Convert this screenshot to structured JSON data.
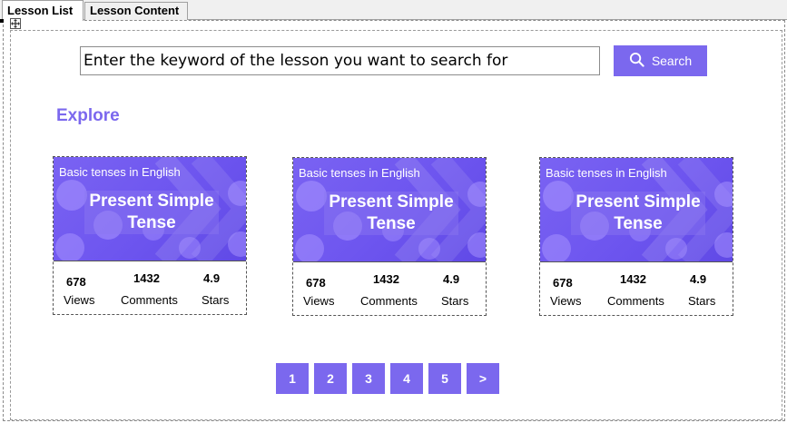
{
  "tabs": [
    {
      "label": "Lesson List",
      "active": true
    },
    {
      "label": "Lesson Content",
      "active": false
    }
  ],
  "search": {
    "value": "Enter the keyword of the lesson you want to search for",
    "button_label": "Search",
    "icon": "search-icon"
  },
  "section_title": "Explore",
  "cards": [
    {
      "category": "Basic tenses in English",
      "title": "Present Simple Tense",
      "views": "678",
      "views_label": "Views",
      "comments": "1432",
      "comments_label": "Comments",
      "stars": "4.9",
      "stars_label": "Stars"
    },
    {
      "category": "Basic tenses in English",
      "title": "Present Simple Tense",
      "views": "678",
      "views_label": "Views",
      "comments": "1432",
      "comments_label": "Comments",
      "stars": "4.9",
      "stars_label": "Stars"
    },
    {
      "category": "Basic tenses in English",
      "title": "Present Simple Tense",
      "views": "678",
      "views_label": "Views",
      "comments": "1432",
      "comments_label": "Comments",
      "stars": "4.9",
      "stars_label": "Stars"
    }
  ],
  "pagination": [
    "1",
    "2",
    "3",
    "4",
    "5",
    ">"
  ],
  "colors": {
    "accent": "#7b68ee",
    "thumb_background": "#6d55ef"
  }
}
